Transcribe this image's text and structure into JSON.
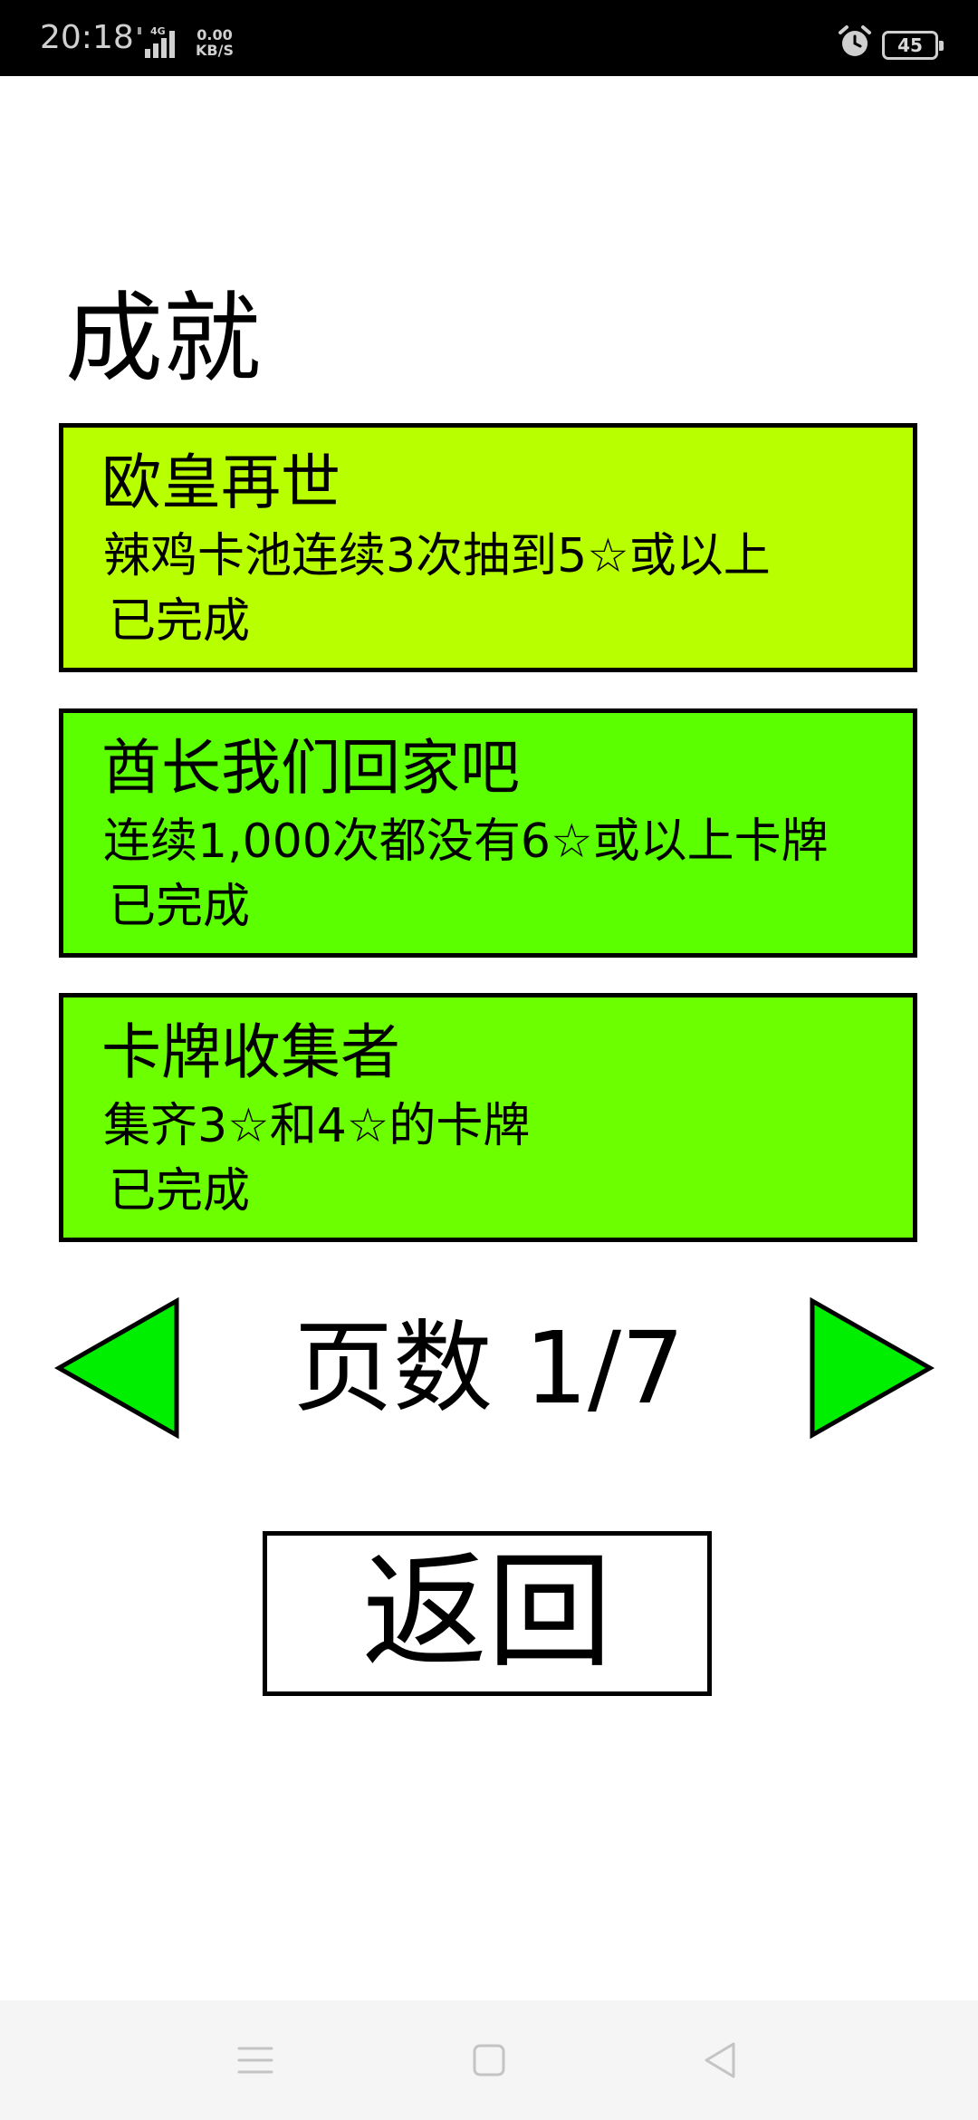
{
  "status_bar": {
    "time": "20:18",
    "network": "4G",
    "speed_value": "0.00",
    "speed_unit": "KB/S",
    "battery": "45"
  },
  "page": {
    "title": "成就"
  },
  "achievements": [
    {
      "title": "欧皇再世",
      "description": "辣鸡卡池连续3次抽到5☆或以上",
      "status": "已完成",
      "color": "#b8ff00"
    },
    {
      "title": "酋长我们回家吧",
      "description": "连续1,000次都没有6☆或以上卡牌",
      "status": "已完成",
      "color": "#5cff00"
    },
    {
      "title": "卡牌收集者",
      "description": "集齐3☆和4☆的卡牌",
      "status": "已完成",
      "color": "#6cff00"
    }
  ],
  "pagination": {
    "label": "页数 1/7",
    "current": 1,
    "total": 7,
    "arrow_color": "#00ee00"
  },
  "back_button": {
    "label": "返回"
  },
  "nav_bar": {
    "icons": [
      "menu-icon",
      "home-square-icon",
      "back-triangle-icon"
    ]
  }
}
